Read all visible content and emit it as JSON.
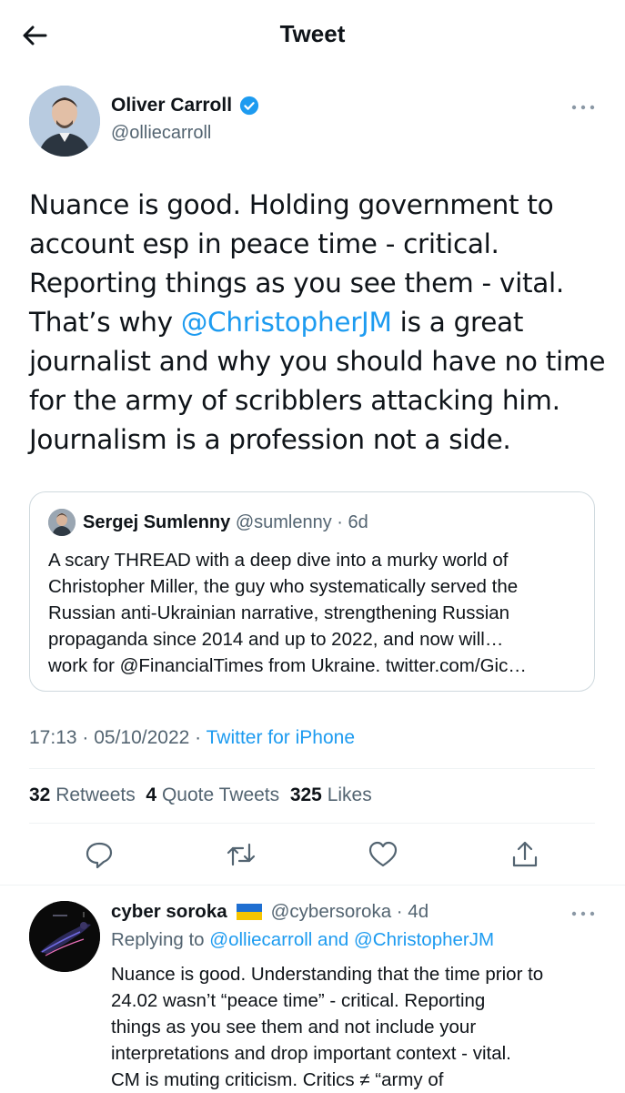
{
  "header": {
    "title": "Tweet",
    "back_icon": "arrow-left-icon"
  },
  "author": {
    "name": "Oliver Carroll",
    "handle": "@olliecarroll",
    "verified": true,
    "more_icon": "more-horizontal-icon"
  },
  "tweet": {
    "lines": [
      "Nuance is good. Holding government to",
      "account esp in peace time - critical.",
      "Reporting things as you see them - vital.",
      "That’s why ",
      " is a great",
      "journalist and why you should have no time",
      "for the army of scribblers attacking him.",
      "Journalism is a profession not a side."
    ],
    "mention": "@ChristopherJM"
  },
  "quote": {
    "name": "Sergej Sumlenny",
    "handle_time": "@sumlenny · 6d",
    "lines": [
      "A scary THREAD with a deep dive into a murky world of",
      "Christopher Miller, the guy who systematically served the",
      "Russian anti-Ukrainian narrative, strengthening Russian",
      "propaganda since 2014 and up to 2022, and now will…",
      "work for @FinancialTimes from Ukraine. twitter.com/Gic…"
    ]
  },
  "meta": {
    "time_date": "17:13 · 05/10/2022 · ",
    "app": "Twitter for iPhone"
  },
  "stats": {
    "retweets_count": "32",
    "retweets_label": " Retweets ",
    "quotes_count": "4",
    "quotes_label": " Quote Tweets ",
    "likes_count": "325",
    "likes_label": " Likes"
  },
  "actions": {
    "reply_icon": "reply-icon",
    "retweet_icon": "retweet-icon",
    "like_icon": "like-icon",
    "share_icon": "share-icon"
  },
  "reply": {
    "name": "cyber soroka",
    "handle_time": "@cybersoroka · 4d",
    "replying_prefix": "Replying to ",
    "replying_to_1": "@olliecarroll",
    "replying_and": " and ",
    "replying_to_2": "@ChristopherJM",
    "lines": [
      "Nuance is good. Understanding that the time prior to",
      "24.02 wasn’t “peace time” - critical. Reporting",
      "things as you see them and not include your",
      "interpretations and drop important context - vital.",
      "CM is muting criticism. Critics ≠ “army of"
    ]
  },
  "colors": {
    "accent": "#1d9bf0",
    "secondary_text": "#536471",
    "text": "#0f1419"
  }
}
